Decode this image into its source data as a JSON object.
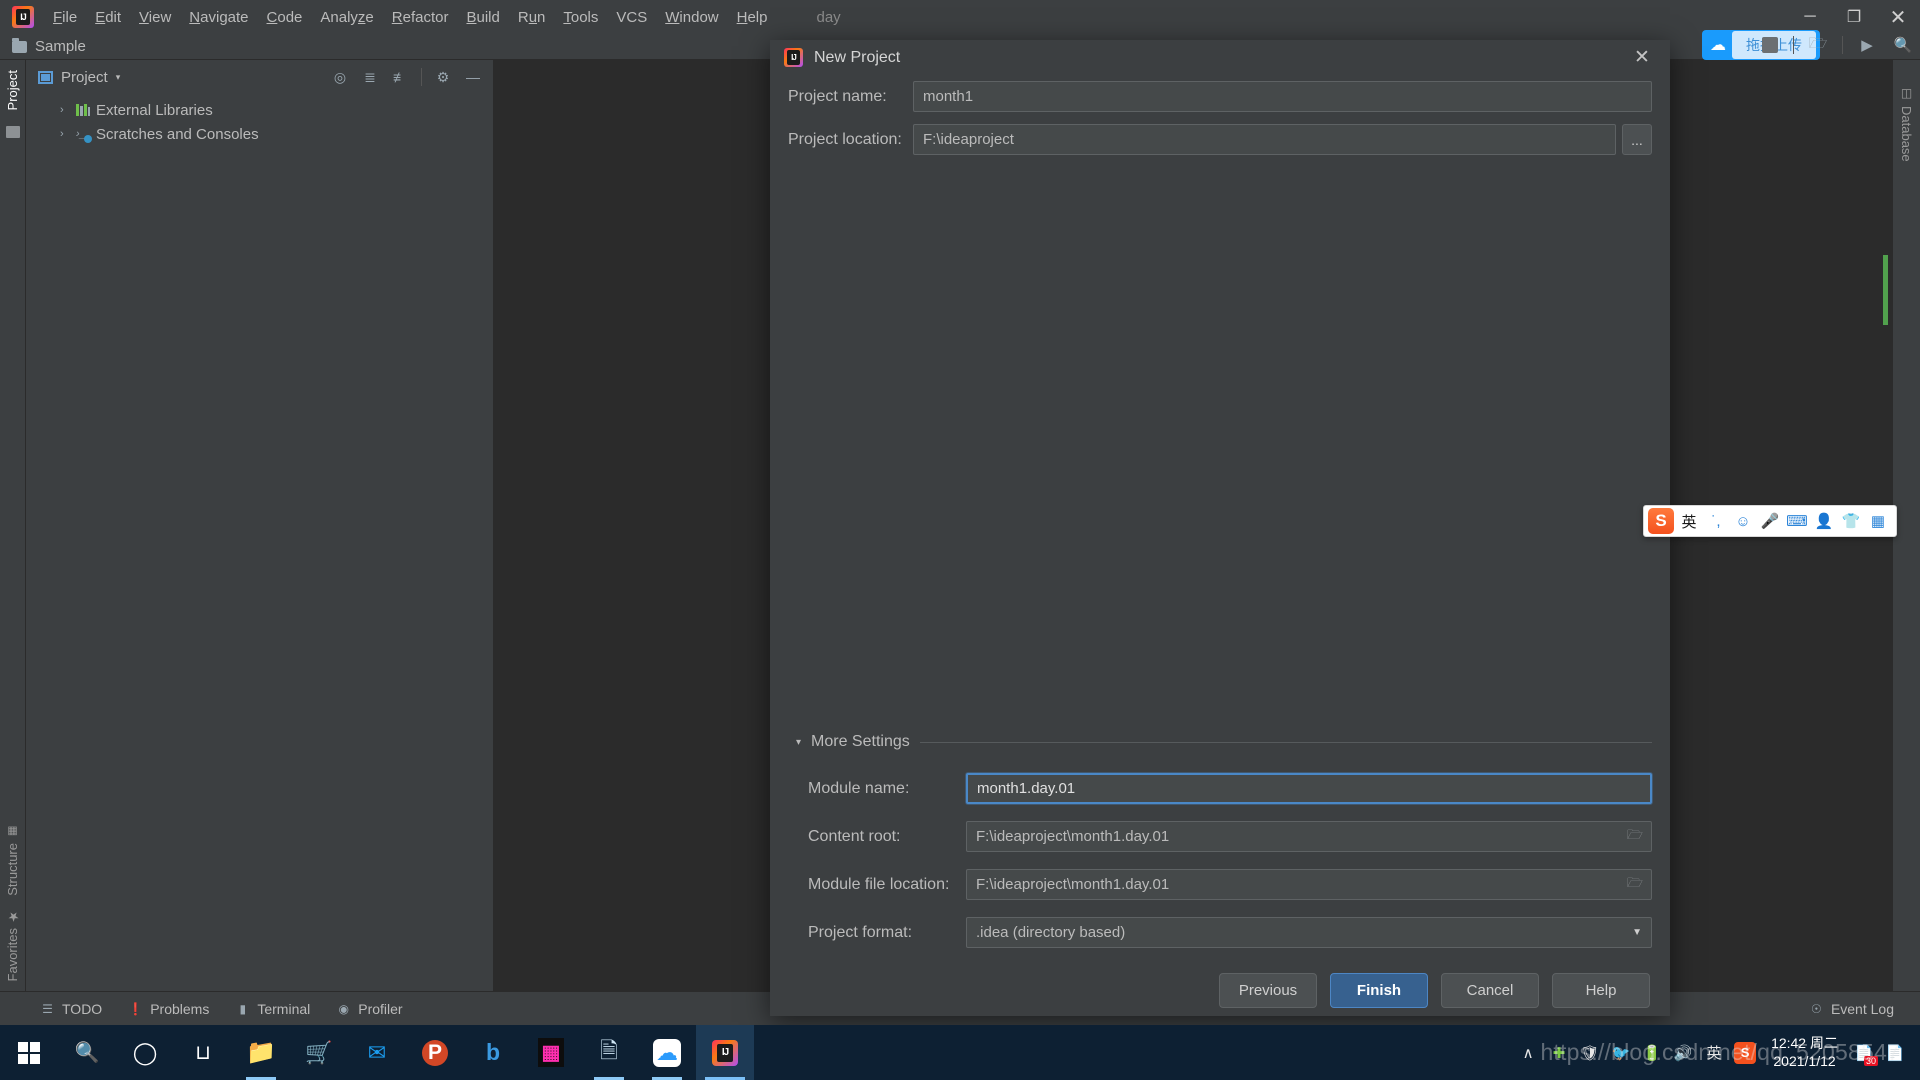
{
  "app": {
    "title_text": "day",
    "menu": [
      {
        "label": "File",
        "mnemonic": "F"
      },
      {
        "label": "Edit",
        "mnemonic": "E"
      },
      {
        "label": "View",
        "mnemonic": "V"
      },
      {
        "label": "Navigate",
        "mnemonic": "N"
      },
      {
        "label": "Code",
        "mnemonic": "C"
      },
      {
        "label": "Analyze",
        "mnemonic": "z"
      },
      {
        "label": "Refactor",
        "mnemonic": "R"
      },
      {
        "label": "Build",
        "mnemonic": "B"
      },
      {
        "label": "Run",
        "mnemonic": "u"
      },
      {
        "label": "Tools",
        "mnemonic": "T"
      },
      {
        "label": "VCS",
        "mnemonic": ""
      },
      {
        "label": "Window",
        "mnemonic": "W"
      },
      {
        "label": "Help",
        "mnemonic": "H"
      }
    ],
    "window_controls": {
      "minimize": "─",
      "maximize": "❐",
      "close": "✕"
    }
  },
  "navbar": {
    "breadcrumb": "Sample"
  },
  "upload_widget": {
    "label": "拖拽上传",
    "icon": "cloud-upload-icon"
  },
  "toolbar_right": {
    "icons": [
      "project-structure-icon",
      "run-icon",
      "search-icon"
    ]
  },
  "left_strip": {
    "top_tabs": [
      {
        "label": "Project",
        "icon": "project-icon",
        "selected": true
      }
    ],
    "bottom_tabs": [
      {
        "label": "Structure",
        "icon": "structure-icon"
      },
      {
        "label": "Favorites",
        "icon": "star-icon"
      }
    ]
  },
  "right_strip": {
    "tabs": [
      {
        "label": "Database",
        "icon": "database-icon"
      }
    ]
  },
  "project_panel": {
    "title": "Project",
    "caret": "▾",
    "tools": [
      "locate-icon",
      "expand-all-icon",
      "collapse-all-icon",
      "settings-gear-icon",
      "hide-icon"
    ],
    "tree": [
      {
        "label": "External Libraries",
        "icon": "library-icon",
        "arrow": "›"
      },
      {
        "label": "Scratches and Consoles",
        "icon": "scratches-icon",
        "arrow": "›"
      }
    ]
  },
  "statusbar": {
    "items": [
      {
        "label": "TODO",
        "icon": "todo-icon"
      },
      {
        "label": "Problems",
        "icon": "problems-icon"
      },
      {
        "label": "Terminal",
        "icon": "terminal-icon"
      },
      {
        "label": "Profiler",
        "icon": "profiler-icon"
      }
    ],
    "event_log": {
      "label": "Event Log",
      "icon": "event-log-icon"
    }
  },
  "dialog": {
    "title": "New Project",
    "close_label": "✕",
    "fields": [
      {
        "label": "Project name:",
        "value": "month1",
        "has_browse": false
      },
      {
        "label": "Project location:",
        "value": "F:\\ideaproject",
        "has_browse": true,
        "browse_label": "..."
      }
    ],
    "more_settings": {
      "label": "More Settings",
      "expanded_arrow": "▾",
      "fields": [
        {
          "label": "Module name:",
          "value": "month1.day.01",
          "type": "text",
          "focused": true
        },
        {
          "label": "Content root:",
          "value": "F:\\ideaproject\\month1.day.01",
          "type": "path",
          "focused": false
        },
        {
          "label": "Module file location:",
          "value": "F:\\ideaproject\\month1.day.01",
          "type": "path",
          "focused": false
        },
        {
          "label": "Project format:",
          "value": ".idea (directory based)",
          "type": "select",
          "focused": false
        }
      ]
    },
    "buttons": [
      {
        "label": "Previous",
        "primary": false
      },
      {
        "label": "Finish",
        "primary": true
      },
      {
        "label": "Cancel",
        "primary": false
      },
      {
        "label": "Help",
        "primary": false
      }
    ]
  },
  "ime_bar": {
    "logo": "S",
    "items": [
      "英",
      "˙,",
      "☺",
      "🎤",
      "⌨",
      "👤",
      "👕",
      "▦"
    ]
  },
  "taskbar": {
    "items": [
      {
        "name": "start-button",
        "icon": "windows-logo"
      },
      {
        "name": "search",
        "icon": "search-icon"
      },
      {
        "name": "cortana",
        "icon": "circle-icon"
      },
      {
        "name": "task-view",
        "icon": "task-view-icon"
      },
      {
        "name": "file-explorer",
        "icon": "folder-icon",
        "running": true
      },
      {
        "name": "microsoft-store",
        "icon": "store-icon"
      },
      {
        "name": "mail",
        "icon": "mail-icon"
      },
      {
        "name": "powerpoint",
        "icon": "powerpoint-icon"
      },
      {
        "name": "edge",
        "icon": "edge-icon"
      },
      {
        "name": "app-pink",
        "icon": "pink-app-icon"
      },
      {
        "name": "sticky-notes",
        "icon": "notes-icon",
        "running": true
      },
      {
        "name": "baidu-netdisk",
        "icon": "cloud-icon",
        "running": true
      },
      {
        "name": "intellij-idea",
        "icon": "idea-icon",
        "active": true
      }
    ],
    "tray": {
      "expand": "∧",
      "icons": [
        "shield-green-icon",
        "windows-defender-icon",
        "qq-icon",
        "battery-icon",
        "volume-icon"
      ],
      "ime": "英",
      "sogou": "S"
    },
    "clock": {
      "time": "12:42 周二",
      "date": "2021/1/12"
    },
    "notifications": {
      "badge": "30"
    }
  },
  "watermark": {
    "text": "https://blog.csdn.net/qq_52058547"
  },
  "colors": {
    "ide_bg": "#3c3f41",
    "editor_bg": "#2b2b2b",
    "accent_blue": "#4a88c7",
    "primary_btn": "#37618f",
    "upload_blue": "#1a9bfc",
    "taskbar": "#0d2033"
  }
}
